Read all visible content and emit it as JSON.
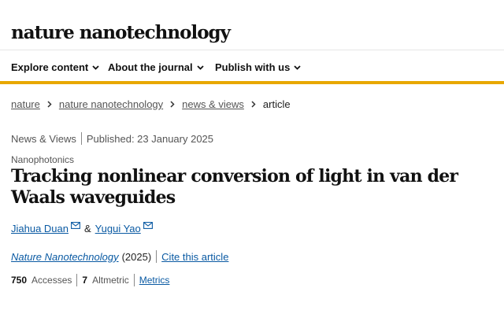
{
  "header": {
    "logo": "nature nanotechnology"
  },
  "nav": {
    "items": [
      {
        "label": "Explore content"
      },
      {
        "label": "About the journal"
      },
      {
        "label": "Publish with us"
      }
    ]
  },
  "breadcrumb": {
    "items": [
      "nature",
      "nature nanotechnology",
      "news & views"
    ],
    "current": "article"
  },
  "article": {
    "type": "News & Views",
    "published": "Published: 23 January 2025",
    "subject": "Nanophotonics",
    "title": "Tracking nonlinear conversion of light in van der Waals waveguides",
    "authors": [
      "Jiahua Duan",
      "Yugui Yao"
    ],
    "author_joiner": "&",
    "journal": "Nature Nanotechnology",
    "year": "(2025)",
    "cite_label": "Cite this article"
  },
  "metrics": {
    "accesses_value": "750",
    "accesses_label": "Accesses",
    "altmetric_value": "7",
    "altmetric_label": "Altmetric",
    "metrics_link": "Metrics"
  },
  "colors": {
    "accent": "#e8a800",
    "link": "#0a5aa3"
  },
  "icons": {
    "nav_dropdown": "chevron-down-icon",
    "breadcrumb_separator": "chevron-right-icon",
    "author_contact": "envelope-icon"
  }
}
